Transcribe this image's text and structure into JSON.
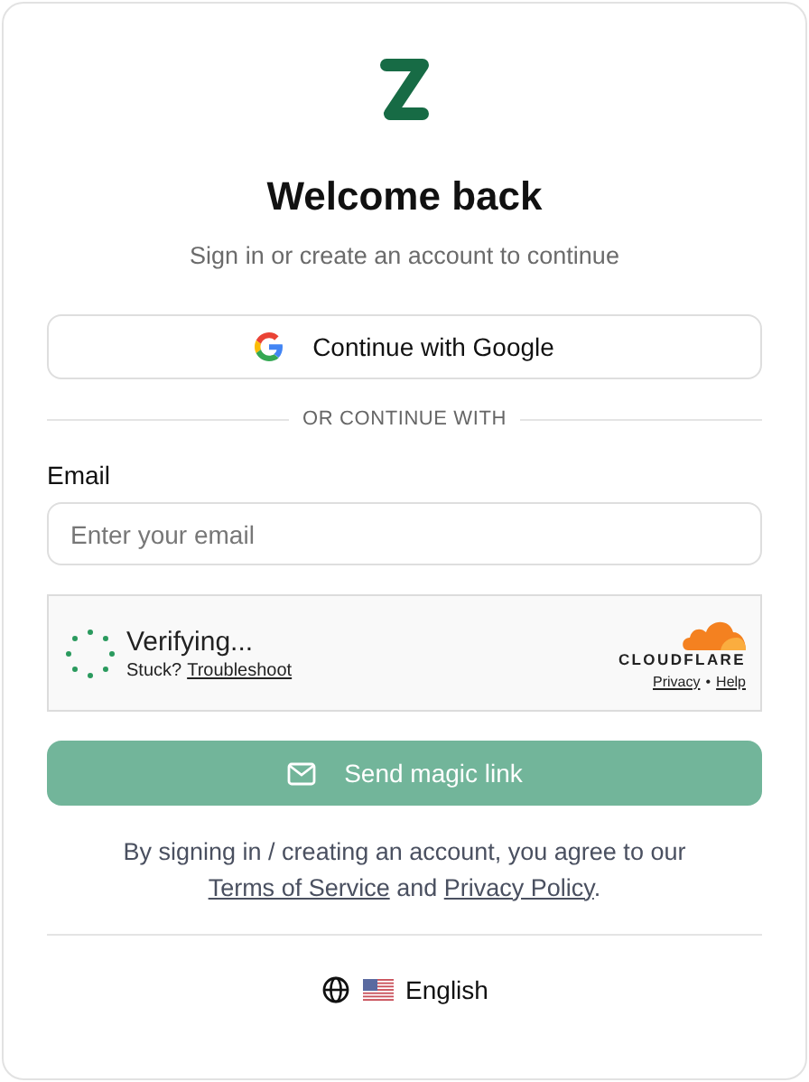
{
  "title": "Welcome back",
  "subtitle": "Sign in or create an account to continue",
  "google_button": {
    "label": "Continue with Google"
  },
  "divider_text": "OR CONTINUE WITH",
  "email": {
    "label": "Email",
    "placeholder": "Enter your email"
  },
  "captcha": {
    "status": "Verifying...",
    "stuck": "Stuck?",
    "troubleshoot": "Troubleshoot",
    "brand": "CLOUDFLARE",
    "privacy": "Privacy",
    "separator": "•",
    "help": "Help"
  },
  "send_button": {
    "label": "Send magic link",
    "disabled": true
  },
  "terms": [
    {
      "kind": "text",
      "text": "By signing in / creating an account, you agree to our "
    },
    {
      "kind": "link",
      "text": "Terms of Service"
    },
    {
      "kind": "text",
      "text": " and "
    },
    {
      "kind": "link",
      "text": "Privacy Policy"
    },
    {
      "kind": "text",
      "text": "."
    }
  ],
  "language": {
    "label": "English"
  }
}
